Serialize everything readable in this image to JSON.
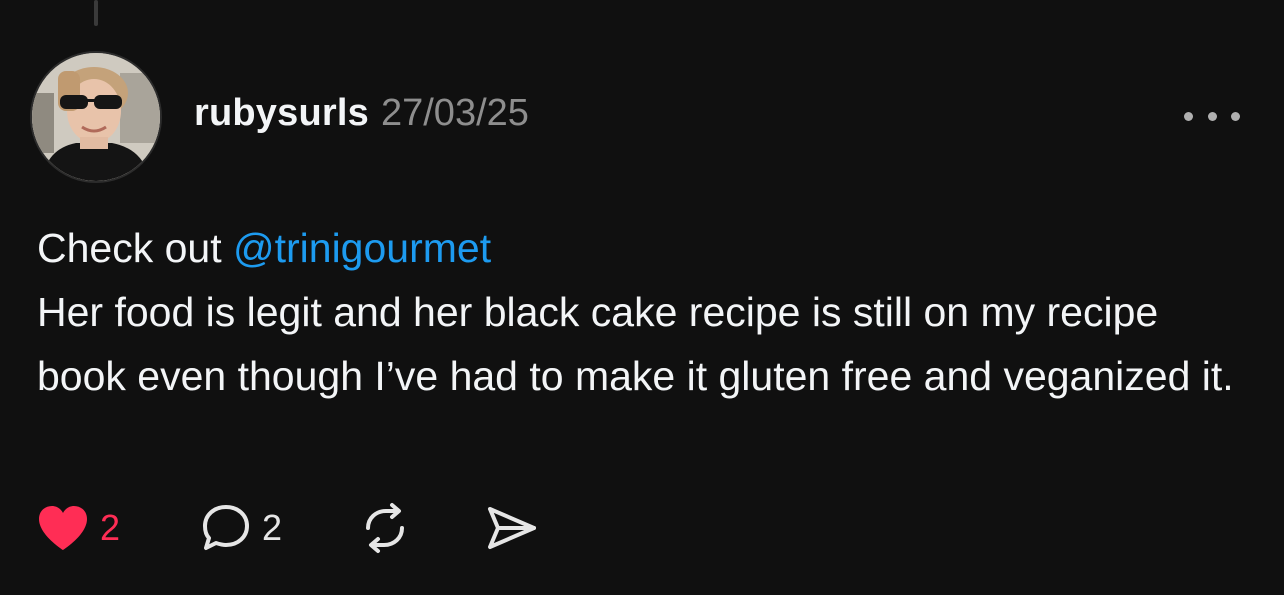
{
  "post": {
    "username": "rubysurls",
    "date": "27/03/25",
    "text_line1_prefix": "Check out ",
    "mention": "@trinigourmet",
    "text_body": "Her food is legit and her black cake recipe is still on my recipe book even though I’ve had to make it gluten free and veganized it."
  },
  "actions": {
    "likes": "2",
    "replies": "2",
    "liked": true
  },
  "icons": {
    "like": "heart-icon",
    "reply": "speech-bubble-icon",
    "repost": "repost-icon",
    "share": "send-icon",
    "more": "more-options-icon"
  },
  "colors": {
    "background": "#101010",
    "like_active": "#ff2d55",
    "mention": "#1d9bf0",
    "secondary_text": "#8e8e8e"
  }
}
